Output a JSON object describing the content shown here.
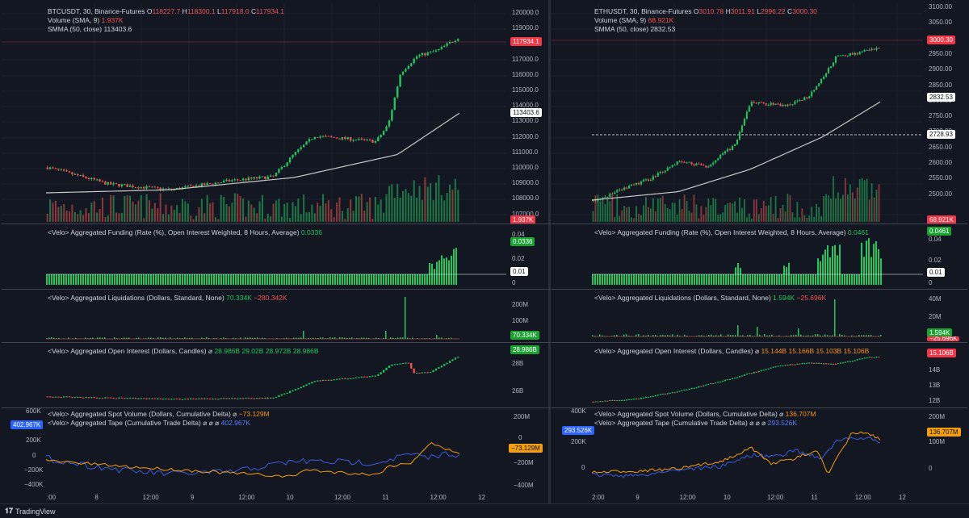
{
  "branding": {
    "footer": "TradingView"
  },
  "colors": {
    "up": "#22c55e",
    "down": "#ef5350",
    "bg": "#131722",
    "sma": "#c8c8c8",
    "spot": "#f59e0b",
    "tape": "#3b5bdb"
  },
  "btc": {
    "title": "BTCUSDT, 30, Binance-Futures",
    "o_lbl": "O",
    "o": "118227.7",
    "h_lbl": "H",
    "h": "118300.1",
    "l_lbl": "L",
    "l": "117918.0",
    "c_lbl": "C",
    "c": "117934.1",
    "vol_lbl": "Volume (SMA, 9)",
    "vol": "1.937K",
    "sma_lbl": "SMMA (50, close)",
    "sma": "113403.6",
    "price_tag": "117934.1",
    "sma_tag": "113403.6",
    "vol_tag": "1.937K",
    "price_ticks": [
      "120000.0",
      "119000.0",
      "118000.0",
      "117000.0",
      "116000.0",
      "115000.0",
      "114000.0",
      "113000.0",
      "112000.0",
      "111000.0",
      "110000.0",
      "109000.0",
      "108000.0",
      "107000.0"
    ],
    "funding_lbl": "<Velo> Aggregated Funding (Rate (%), Open Interest Weighted, 8 Hours, Average)",
    "funding_val": "0.0336",
    "funding_ticks": [
      "0.04",
      "0.02",
      "0"
    ],
    "funding_tag": "0.0336",
    "funding_tag2": "0.01",
    "liq_lbl": "<Velo> Aggregated Liquidations (Dollars, Standard, None)",
    "liq_v1": "70.334K",
    "liq_v2": "−280.342K",
    "liq_ticks": [
      "200M",
      "100M"
    ],
    "liq_tag": "70.334K",
    "oi_lbl": "<Velo> Aggregated Open Interest (Dollars, Candles)",
    "oi_sym": "⌀",
    "oi_o": "28.986B",
    "oi_h": "29.02B",
    "oi_l": "28.972B",
    "oi_c": "28.986B",
    "oi_ticks": [
      "28B",
      "26B"
    ],
    "oi_tag": "28.986B",
    "spot_lbl": "<Velo> Aggregated Spot Volume (Dollars, Cumulative Delta)",
    "spot_sym": "⌀",
    "spot_val": "−73.129M",
    "tape_lbl": "<Velo> Aggregated Tape (Cumulative Trade Delta)",
    "tape_syms": "⌀ ⌀ ⌀",
    "tape_val": "402.967K",
    "left_ticks": [
      "600K",
      "200K",
      "0",
      "−200K",
      "−400K"
    ],
    "left_tag": "402.967K",
    "right_ticks": [
      "200M",
      "0",
      "−200M",
      "−400M"
    ],
    "right_tag": "−73.129M",
    "x_ticks": [
      ":00",
      "8",
      "12:00",
      "9",
      "12:00",
      "10",
      "12:00",
      "11",
      "12:00",
      "12"
    ]
  },
  "eth": {
    "title": "ETHUSDT, 30, Binance-Futures",
    "o_lbl": "O",
    "o": "3010.78",
    "h_lbl": "H",
    "h": "3011.91",
    "l_lbl": "L",
    "l": "2996.22",
    "c_lbl": "C",
    "c": "3000.30",
    "vol_lbl": "Volume (SMA, 9)",
    "vol": "68.921K",
    "sma_lbl": "SMMA (50, close)",
    "sma": "2832.53",
    "price_tag": "3000.30",
    "sma_tag": "2832.53",
    "line_tag": "2728.93",
    "vol_tag": "68.921K",
    "price_ticks": [
      "3100.00",
      "3050.00",
      "3000.00",
      "2950.00",
      "2900.00",
      "2850.00",
      "2800.00",
      "2750.00",
      "2700.00",
      "2650.00",
      "2600.00",
      "2550.00",
      "2500.00"
    ],
    "funding_lbl": "<Velo> Aggregated Funding (Rate (%), Open Interest Weighted, 8 Hours, Average)",
    "funding_val": "0.0461",
    "funding_ticks": [
      "0.04",
      "0.02",
      "0"
    ],
    "funding_tag": "0.0461",
    "funding_tag2": "0.01",
    "liq_lbl": "<Velo> Aggregated Liquidations (Dollars, Standard, None)",
    "liq_v1": "1.594K",
    "liq_v2": "−25.696K",
    "liq_ticks": [
      "40M",
      "20M"
    ],
    "liq_tag": "1.594K",
    "liq_tag2": "−25.696K",
    "oi_lbl": "<Velo> Aggregated Open Interest (Dollars, Candles)",
    "oi_sym": "⌀",
    "oi_o": "15.144B",
    "oi_h": "15.166B",
    "oi_l": "15.103B",
    "oi_c": "15.106B",
    "oi_ticks": [
      "14B",
      "13B",
      "12B"
    ],
    "oi_tag": "15.106B",
    "spot_lbl": "<Velo> Aggregated Spot Volume (Dollars, Cumulative Delta)",
    "spot_sym": "⌀",
    "spot_val": "136.707M",
    "tape_lbl": "<Velo> Aggregated Tape (Cumulative Trade Delta)",
    "tape_syms": "⌀ ⌀ ⌀",
    "tape_val": "293.526K",
    "left_ticks": [
      "400K",
      "200K",
      "0"
    ],
    "left_tag": "293.526K",
    "right_ticks": [
      "200M",
      "100M",
      "0"
    ],
    "right_tag": "136.707M",
    "x_ticks": [
      "2:00",
      "9",
      "12:00",
      "10",
      "12:00",
      "11",
      "12:00",
      "12"
    ]
  }
}
